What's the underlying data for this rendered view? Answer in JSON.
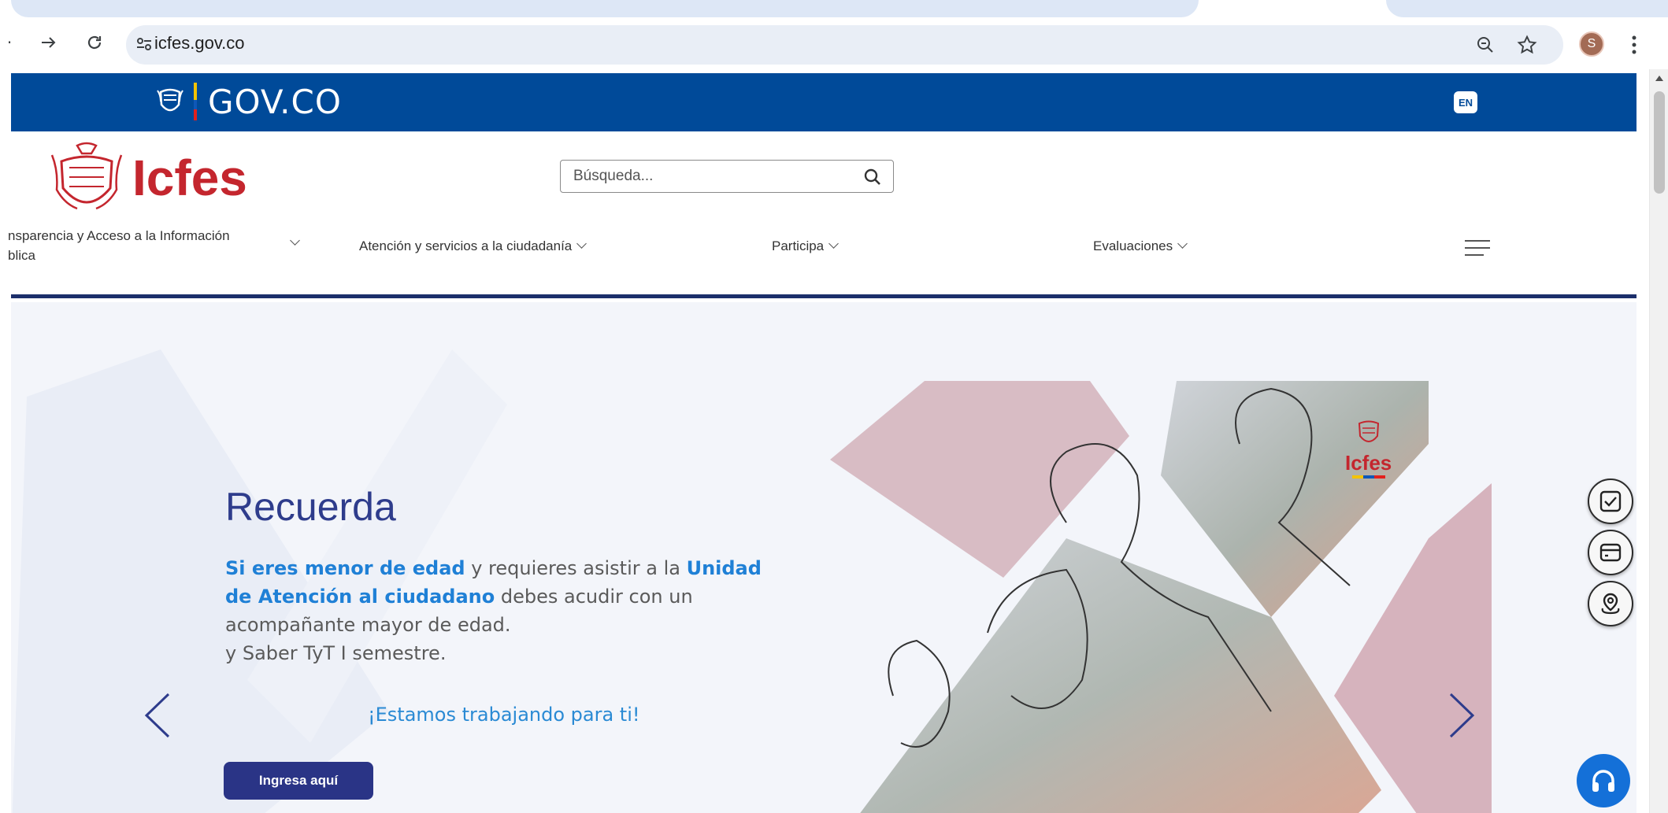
{
  "browser": {
    "url": "icfes.gov.co",
    "profile_initial": "S"
  },
  "gov_bar": {
    "brand": "GOV.CO",
    "language_button": "EN"
  },
  "header": {
    "brand": "Icfes",
    "search_placeholder": "Búsqueda..."
  },
  "nav": {
    "items": [
      {
        "label_line1": "nsparencia y Acceso a la Información",
        "label_line2": "blica"
      },
      {
        "label": "Atención y servicios a la ciudadanía"
      },
      {
        "label": "Participa"
      },
      {
        "label": "Evaluaciones"
      }
    ]
  },
  "hero": {
    "title": "Recuerda",
    "emphasis_1": "Si eres menor de edad",
    "text_1": " y requieres asistir a la ",
    "emphasis_2": "Unidad de Atención al ciudadano",
    "text_2": " debes acudir con un acompañante mayor de edad.",
    "line_2": "y Saber TyT I semestre.",
    "tagline": "¡Estamos trabajando para ti!",
    "button": "Ingresa aquí",
    "image_logo_text": "Icfes"
  },
  "colors": {
    "gov_blue": "#004a99",
    "brand_red": "#c4262e",
    "nav_navy": "#1c2f6b",
    "link_blue": "#1f80d6",
    "button_navy": "#2a3486"
  }
}
